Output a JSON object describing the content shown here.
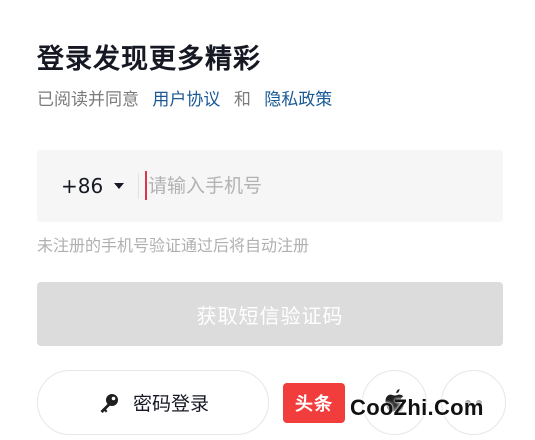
{
  "title": "登录发现更多精彩",
  "agreement": {
    "prefix": "已阅读并同意",
    "user_agreement": "用户协议",
    "conjunction": "和",
    "privacy_policy": "隐私政策"
  },
  "phone": {
    "country_code": "+86",
    "placeholder": "请输入手机号",
    "value": ""
  },
  "hint": "未注册的手机号验证通过后将自动注册",
  "sms_button_label": "获取短信验证码",
  "password_login_label": "密码登录",
  "third_party": {
    "toutiao_label": "头条",
    "apple_icon": "apple-icon",
    "more_icon": "more-dots-icon"
  },
  "watermark": "CooZhi.Com",
  "colors": {
    "link": "#1a5a96",
    "cursor": "#e0334d",
    "button_disabled": "#dcdcdc",
    "toutiao_red": "#f23d3d"
  }
}
